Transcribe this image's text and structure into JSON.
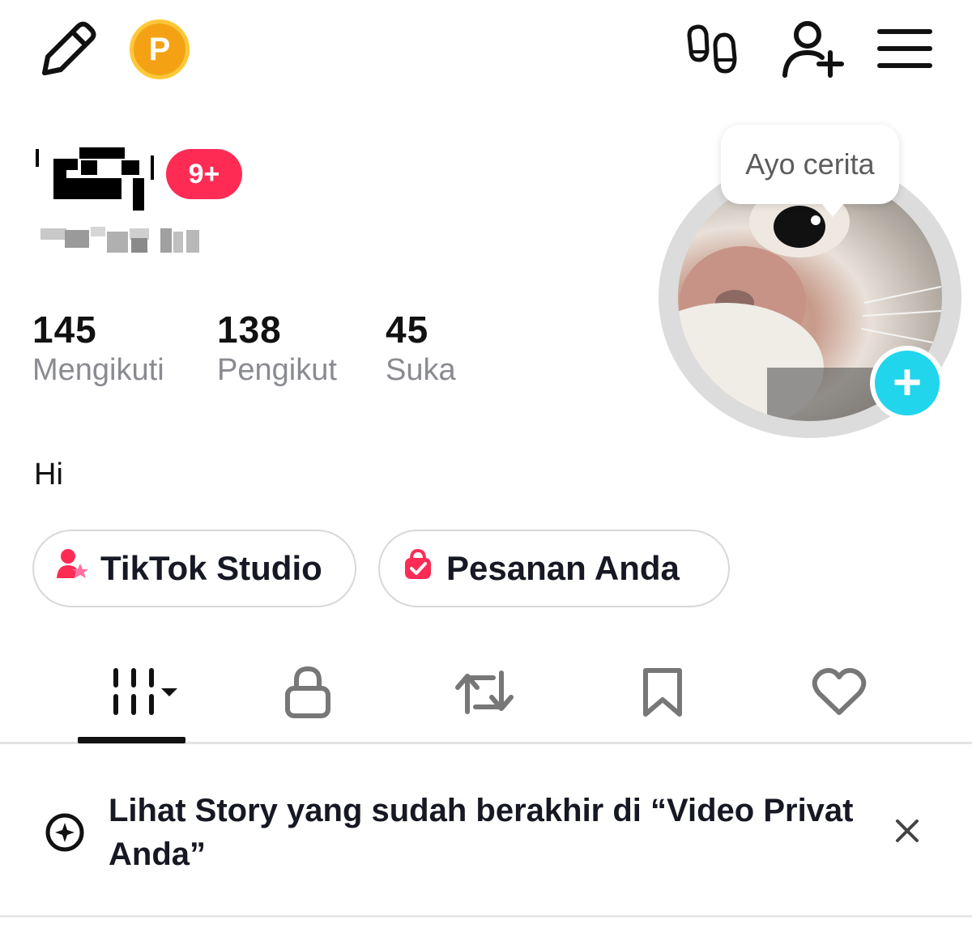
{
  "header": {
    "edit_icon": "pencil-icon",
    "coin_label": "P",
    "icons": [
      "footprints-icon",
      "add-friend-icon",
      "menu-icon"
    ]
  },
  "profile": {
    "notification_badge": "9+",
    "story_prompt": "Ayo cerita",
    "bio": "Hi"
  },
  "stats": [
    {
      "value": "145",
      "label": "Mengikuti"
    },
    {
      "value": "138",
      "label": "Pengikut"
    },
    {
      "value": "45",
      "label": "Suka"
    }
  ],
  "pills": [
    {
      "label": "TikTok Studio",
      "icon": "creator-studio-icon"
    },
    {
      "label": "Pesanan Anda",
      "icon": "shopping-bag-icon"
    }
  ],
  "tabs": [
    {
      "name": "videos",
      "icon": "grid-icon",
      "active": true
    },
    {
      "name": "private",
      "icon": "lock-icon"
    },
    {
      "name": "reposts",
      "icon": "repost-icon"
    },
    {
      "name": "favorites",
      "icon": "bookmark-icon"
    },
    {
      "name": "liked",
      "icon": "heart-icon"
    }
  ],
  "banner": {
    "text": "Lihat Story yang sudah berakhir di “Video Privat Anda”",
    "close_icon": "close-icon"
  },
  "colors": {
    "accent_red": "#fe2c55",
    "accent_cyan": "#20d5ec",
    "coin_orange": "#f4a213",
    "muted_text": "#8a8b91"
  }
}
